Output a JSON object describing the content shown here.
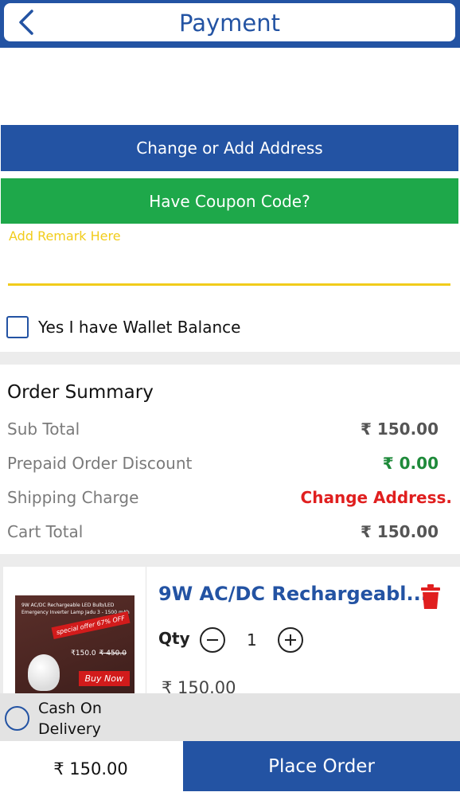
{
  "header": {
    "title": "Payment",
    "back_icon": "chevron-left-icon"
  },
  "buttons": {
    "address": "Change or Add Address",
    "coupon": "Have Coupon Code?"
  },
  "remark": {
    "placeholder": "Add Remark Here"
  },
  "wallet": {
    "label": "Yes I have Wallet Balance",
    "checked": false
  },
  "summary": {
    "title": "Order Summary",
    "rows": [
      {
        "label": "Sub Total",
        "value": "₹ 150.00"
      },
      {
        "label": "Prepaid Order Discount",
        "value": "₹ 0.00"
      },
      {
        "label": "Shipping Charge",
        "value": "Change Address."
      },
      {
        "label": "Cart Total",
        "value": "₹ 150.00"
      }
    ]
  },
  "product": {
    "name": "9W AC/DC Rechargeabl...",
    "qty_label": "Qty",
    "qty": "1",
    "price": "₹ 150.00",
    "image": {
      "title": "9W AC/DC Rechargeable LED Bulb/LED Emergency Inverter Lamp Jadu 3 - 1500 mAh",
      "badge": "special offer 67% OFF",
      "price": "₹150.0",
      "old_price": "₹ 450.0",
      "cta": "Buy Now"
    }
  },
  "payment_option": {
    "label": "Cash On Delivery",
    "selected": false
  },
  "footer": {
    "total": "₹ 150.00",
    "place_order": "Place Order"
  },
  "colors": {
    "primary": "#2353a3",
    "green": "#1ea84a",
    "yellow": "#f1cc1b",
    "red": "#e01f1f"
  }
}
